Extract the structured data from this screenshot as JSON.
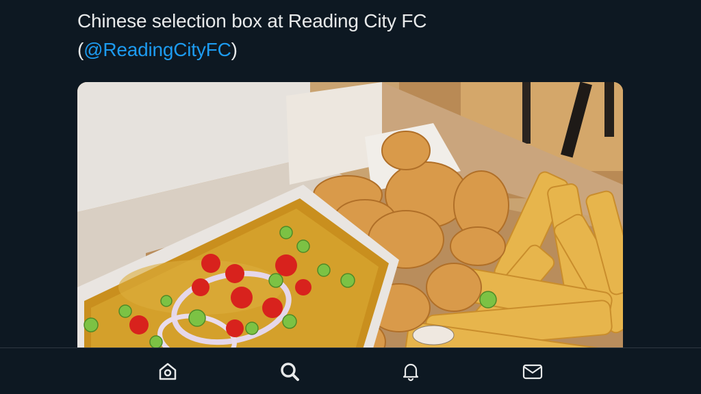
{
  "tweet": {
    "text": "Chinese selection box at Reading City FC",
    "open_paren": "(",
    "mention": "@ReadingCityFC",
    "close_paren": ")"
  },
  "media": {
    "icon": "food-photo"
  },
  "bottom_nav": {
    "items": [
      {
        "icon": "home-icon",
        "active": false
      },
      {
        "icon": "search-icon",
        "active": true
      },
      {
        "icon": "bell-icon",
        "active": false
      },
      {
        "icon": "mail-icon",
        "active": false
      }
    ]
  },
  "colors": {
    "background": "#0d1822",
    "text": "#e7e9ea",
    "link": "#1d9bf0",
    "divider": "#2f3942"
  }
}
